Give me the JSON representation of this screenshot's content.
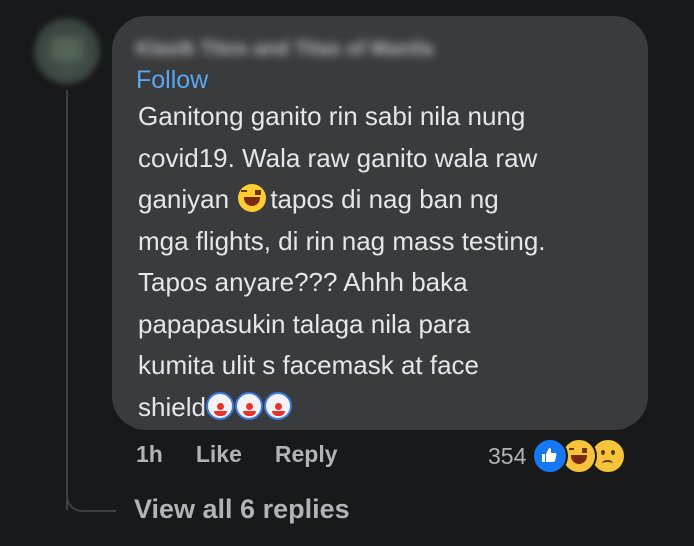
{
  "comment": {
    "author": "Klasik Titos and Titas of Manila",
    "follow_label": "Follow",
    "text_lines": [
      "Ganitong ganito rin sabi nila nung",
      "covid19. Wala raw ganito wala raw",
      "ganiyan",
      "tapos di nag ban ng",
      "mga flights, di rin nag mass testing.",
      "Tapos anyare??? Ahhh baka",
      "papapasukin talaga nila para",
      "kumita ulit s facemask at face",
      "shield"
    ],
    "emojis": {
      "inline": "face-with-tears-of-joy",
      "trailing": [
        "clown-face",
        "clown-face",
        "clown-face"
      ]
    }
  },
  "actions": {
    "time": "1h",
    "like_label": "Like",
    "reply_label": "Reply"
  },
  "reactions": {
    "count": "354",
    "types": [
      "like-reaction-icon",
      "haha-reaction-icon",
      "sad-reaction-icon"
    ],
    "colors": {
      "like": "#1877f2",
      "face": "#f7c33a"
    }
  },
  "view_replies_label": "View all 6 replies",
  "colors": {
    "background": "#18191a",
    "bubble": "#3a3b3c",
    "text": "#e4e6eb",
    "secondary": "#b0b3b8",
    "link": "#5aa7f2"
  }
}
